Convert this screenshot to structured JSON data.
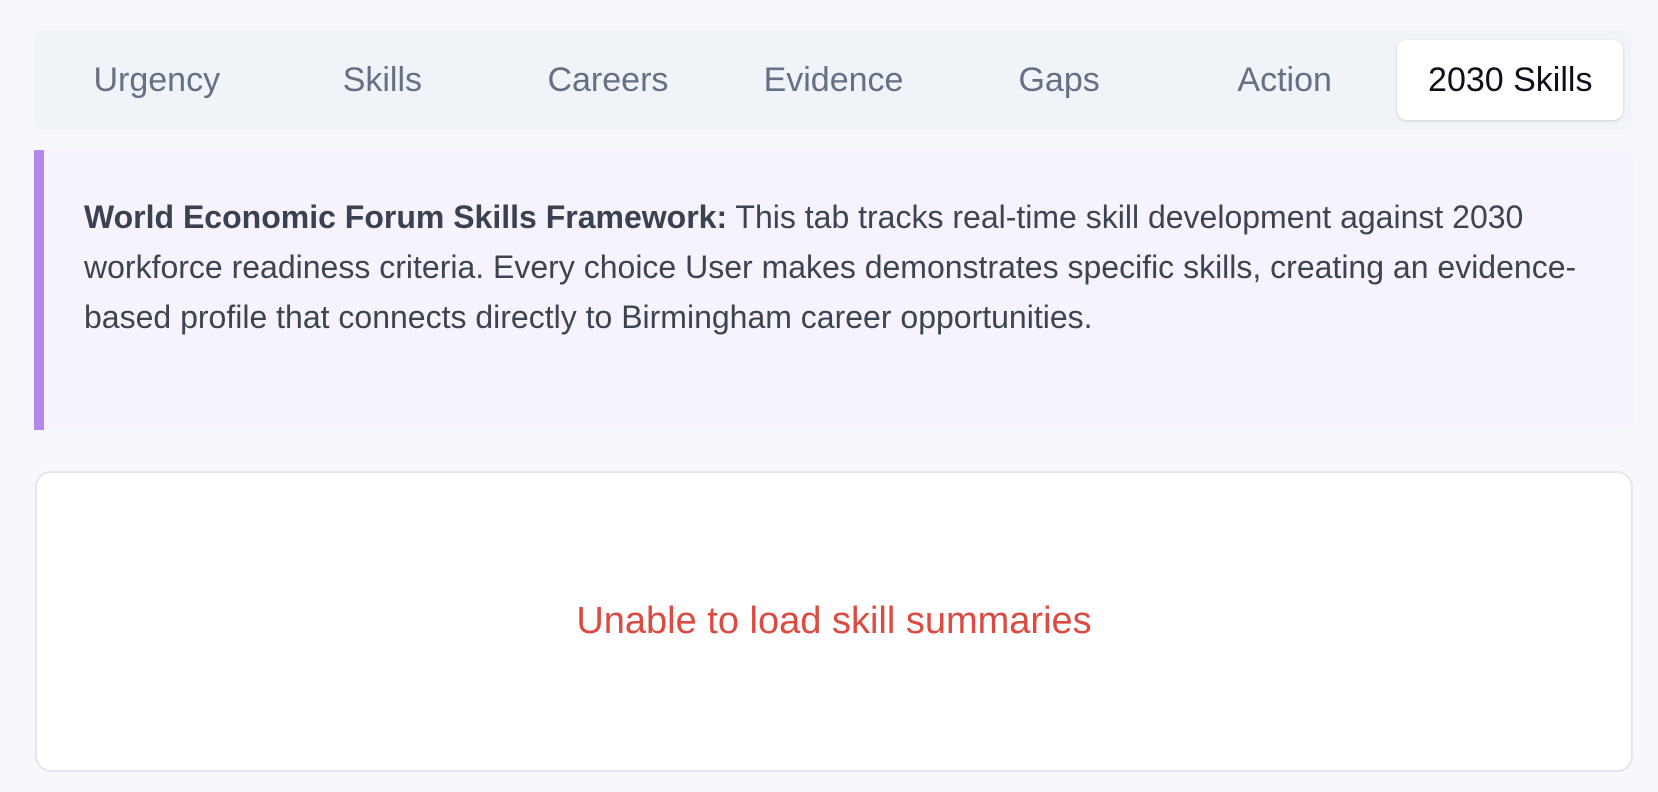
{
  "tabs": [
    {
      "label": "Urgency",
      "active": false
    },
    {
      "label": "Skills",
      "active": false
    },
    {
      "label": "Careers",
      "active": false
    },
    {
      "label": "Evidence",
      "active": false
    },
    {
      "label": "Gaps",
      "active": false
    },
    {
      "label": "Action",
      "active": false
    },
    {
      "label": "2030 Skills",
      "active": true
    }
  ],
  "info": {
    "heading": "World Economic Forum Skills Framework:",
    "body": "This tab tracks real-time skill development against 2030 workforce readiness criteria. Every choice User makes demonstrates specific skills, creating an evidence-based profile that connects directly to Birmingham career opportunities."
  },
  "panel": {
    "error_message": "Unable to load skill summaries"
  },
  "colors": {
    "accent_border": "#b587ea",
    "error": "#dc4a42",
    "active_tab_bg": "#ffffff"
  }
}
